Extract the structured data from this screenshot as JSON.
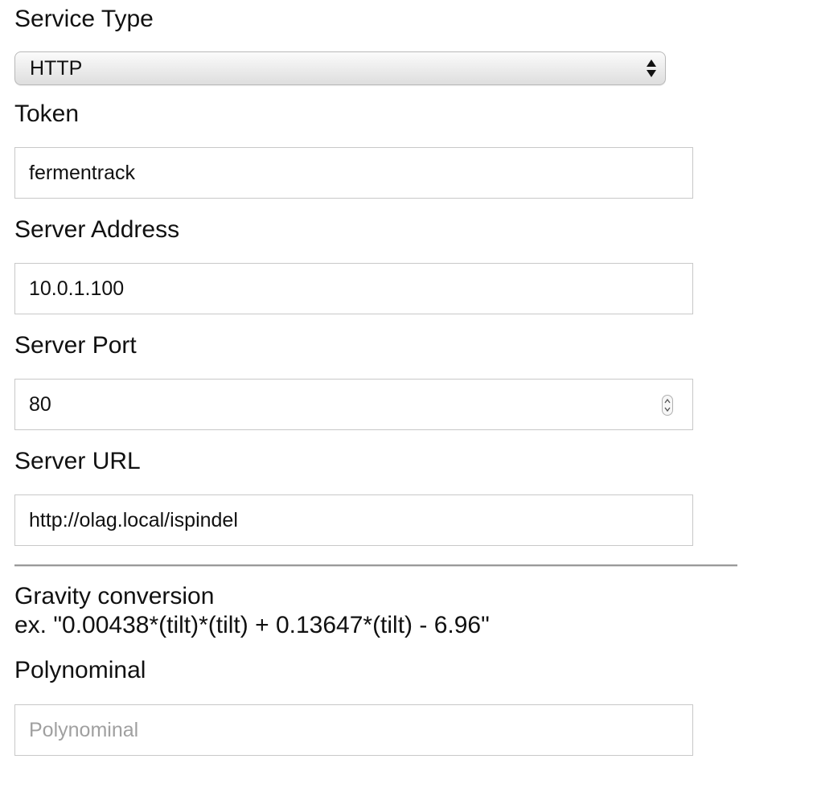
{
  "service_type": {
    "label": "Service Type",
    "selected": "HTTP",
    "icon": "select-up-down-arrows-icon"
  },
  "token": {
    "label": "Token",
    "value": "fermentrack"
  },
  "server_address": {
    "label": "Server Address",
    "value": "10.0.1.100"
  },
  "server_port": {
    "label": "Server Port",
    "value": "80",
    "icon": "number-stepper-icon"
  },
  "server_url": {
    "label": "Server URL",
    "value": "http://olag.local/ispindel"
  },
  "gravity_conversion": {
    "heading": "Gravity conversion",
    "example": "ex. \"0.00438*(tilt)*(tilt) + 0.13647*(tilt) - 6.96\""
  },
  "polynominal": {
    "label": "Polynominal",
    "placeholder": "Polynominal"
  },
  "colors": {
    "text": "#111111",
    "placeholder": "#a0a0a0",
    "border": "#c8c8c8",
    "divider": "#9a9a9a"
  }
}
